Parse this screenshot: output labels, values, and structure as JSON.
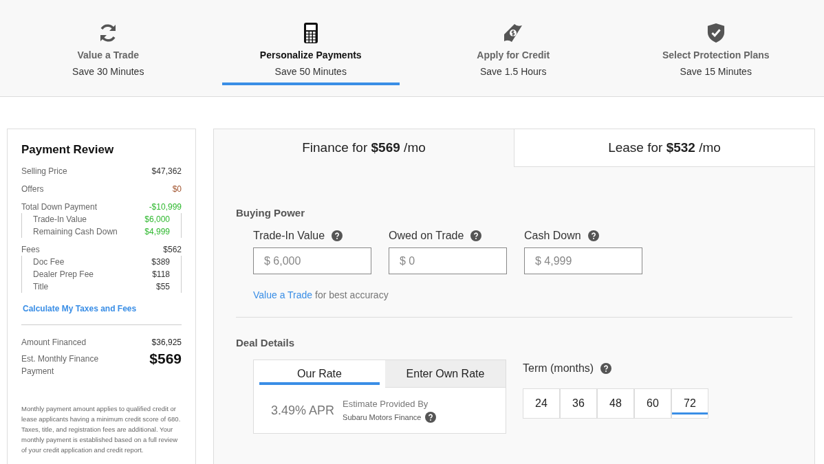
{
  "steps": [
    {
      "title": "Value a Trade",
      "subtitle": "Save 30 Minutes",
      "selected": false
    },
    {
      "title": "Personalize Payments",
      "subtitle": "Save 50 Minutes",
      "selected": true
    },
    {
      "title": "Apply for Credit",
      "subtitle": "Save 1.5 Hours",
      "selected": false
    },
    {
      "title": "Select Protection Plans",
      "subtitle": "Save 15 Minutes",
      "selected": false
    }
  ],
  "payment_review": {
    "title": "Payment Review",
    "groups": [
      {
        "label": "Selling Price",
        "value": "$47,362",
        "color": "#333333"
      },
      {
        "label": "Offers",
        "value": "$0",
        "color": "#a0522d"
      },
      {
        "label": "Total Down Payment",
        "value": "-$10,999",
        "color": "#2eb82e",
        "items": [
          {
            "label": "Trade-In Value",
            "value": "$6,000",
            "color": "#2eb82e"
          },
          {
            "label": "Remaining Cash Down",
            "value": "$4,999",
            "color": "#2eb82e"
          }
        ]
      },
      {
        "label": "Fees",
        "value": "$562",
        "color": "#333333",
        "items": [
          {
            "label": "Doc Fee",
            "value": "$389",
            "color": "#333333"
          },
          {
            "label": "Dealer Prep Fee",
            "value": "$118",
            "color": "#333333"
          },
          {
            "label": "Title",
            "value": "$55",
            "color": "#333333"
          }
        ]
      }
    ],
    "link": "Calculate My Taxes and Fees",
    "amount_financed": {
      "label": "Amount Financed",
      "value": "$36,925"
    },
    "monthly": {
      "label": "Est. Monthly Finance Payment",
      "value": "$569"
    },
    "disclaimer": "Monthly payment amount applies to qualified credit or lease applicants having a minimum credit score of 680.  Taxes, title, and registration fees are additional. Your monthly payment is established based on a full review of your credit application and credit report."
  },
  "tabs": [
    {
      "label": "Finance for **$569** /mo",
      "selected": true
    },
    {
      "label": "Lease for **$532** /mo",
      "selected": false
    }
  ],
  "buying_power": {
    "title": "Buying Power",
    "fields": [
      {
        "label": "Trade-In Value",
        "placeholder": "$ 6,000"
      },
      {
        "label": "Owed on Trade",
        "placeholder": "$ 0"
      },
      {
        "label": "Cash Down",
        "placeholder": "$ 4,999"
      }
    ],
    "link": "Value a Trade",
    "link_suffix": "for best accuracy"
  },
  "deal_details": {
    "title": "Deal Details",
    "rate_tabs": [
      {
        "label": "Our Rate",
        "selected": true
      },
      {
        "label": "Enter Own Rate",
        "selected": false
      }
    ],
    "apr": "3.49% APR",
    "estimate_label": "Estimate Provided By",
    "lender": "Subaru Motors Finance",
    "term_label": "Term (months)",
    "terms": [
      {
        "label": "24",
        "selected": false
      },
      {
        "label": "36",
        "selected": false
      },
      {
        "label": "48",
        "selected": false
      },
      {
        "label": "60",
        "selected": false
      },
      {
        "label": "72",
        "selected": true
      }
    ]
  }
}
